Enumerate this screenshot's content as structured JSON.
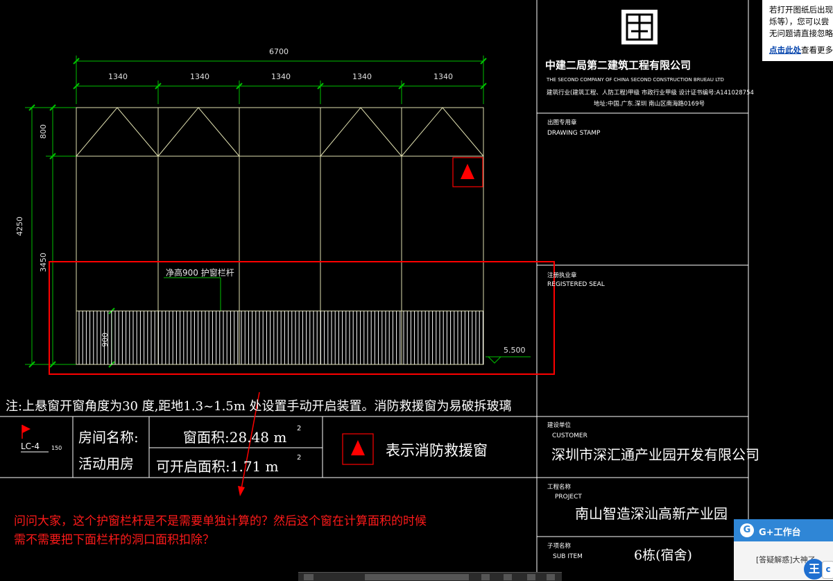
{
  "colors": {
    "background": "#000000",
    "dimension": "#00c000",
    "window_line": "#d8d8a0",
    "frame": "#ffffff",
    "markup_red": "#ff0000",
    "fire_triangle": "#ff0000"
  },
  "drawing": {
    "dims": {
      "total_width": "6700",
      "segment_width": "1340",
      "total_height": "4250",
      "top_height": "800",
      "lower_height": "3450",
      "rail_height": "900",
      "elevation": "5.500"
    },
    "railing_label": "净高900  护窗栏杆",
    "note": "注:上悬窗开窗角度为30  度,距地1.3~1.5m    处设置手动开启装置。消防救援窗为易破拆玻璃"
  },
  "window_table": {
    "tag": "LC-4",
    "scale": "150",
    "room_name_label": "房间名称:",
    "room_name_value": "活动用房",
    "window_area": "窗面积:28.48    m",
    "openable_area": "可开启面积:1.71    m",
    "superscript": "2",
    "legend_text": "表示消防救援窗"
  },
  "title_block": {
    "company_cn": "中建二局第二建筑工程有限公司",
    "company_en": "THE SECOND COMPANY OF CHINA SECOND CONSTRUCTION BRUEAU LTD",
    "qualification": "建筑行业(建筑工程、人防工程)甲级  市政行业甲级  设计证书编号:A141028754",
    "address": "地址:中国.广东.深圳 南山区南海路0169号",
    "stamp_cn": "出图专用章",
    "stamp_en": "DRAWING STAMP",
    "seal_cn": "注册执业章",
    "seal_en": "REGISTERED SEAL",
    "customer_cn": "建设单位",
    "customer_en": "CUSTOMER",
    "customer_name": "深圳市深汇通产业园开发有限公司",
    "project_cn": "工程名称",
    "project_en": "PROJECT",
    "project_name": "南山智造深汕高新产业园",
    "subitem_cn": "子项名称",
    "subitem_en": "SUB ITEM",
    "subitem_name": "6栋(宿舍)"
  },
  "question": {
    "line1": "问问大家，这个护窗栏杆是不是需要单独计算的？然后这个窗在计算面积的时候",
    "line2": "需不需要把下面栏杆的洞口面积扣除？"
  },
  "tooltip": {
    "line1": "若打开图纸后出现",
    "line2": "烁等），您可以尝",
    "line3": "无问题请直接忽略",
    "link": "点击此处",
    "link_rest": "查看更多"
  },
  "gplus": {
    "title": "G+工作台",
    "item": "[答疑解惑]大神了",
    "avatar": "王",
    "bubble": "c"
  }
}
